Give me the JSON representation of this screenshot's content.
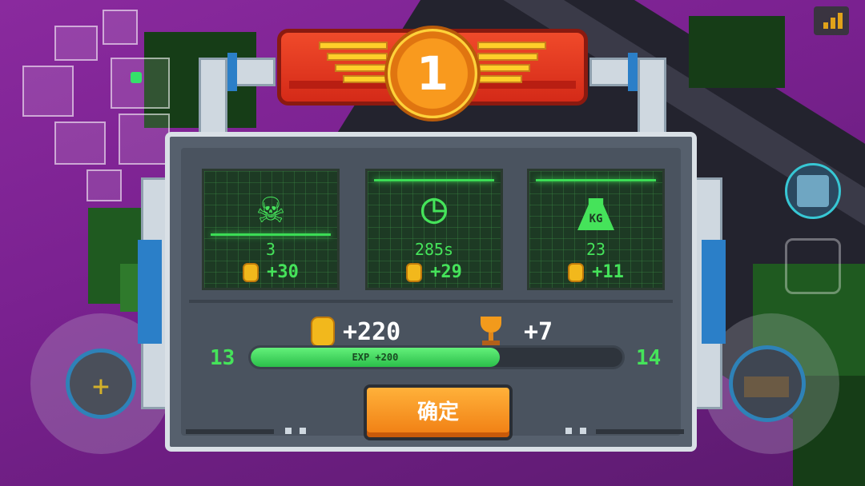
{
  "game": {
    "rank": "1",
    "stats": [
      {
        "name": "kills",
        "icon": "skull-icon",
        "value": "3",
        "reward": "+30"
      },
      {
        "name": "time",
        "icon": "clock-icon",
        "value": "285s",
        "reward": "+29"
      },
      {
        "name": "weight",
        "icon": "kg-weight-icon",
        "value": "23",
        "reward": "+11"
      }
    ],
    "totals": {
      "coins": "+220",
      "trophies": "+7"
    },
    "level": {
      "current": "13",
      "next": "14",
      "exp_label": "EXP +200",
      "exp_fraction": 0.67
    },
    "confirm_label": "确定"
  },
  "colors": {
    "accent_green": "#45e35a",
    "confirm_orange": "#f07d12",
    "banner_red": "#d42a18",
    "coin_gold": "#f2b81c"
  },
  "hud_icons": [
    "minimap-icon",
    "signal-strength-icon",
    "team-skill-icon",
    "move-joystick-icon",
    "weapon-joystick-icon"
  ]
}
